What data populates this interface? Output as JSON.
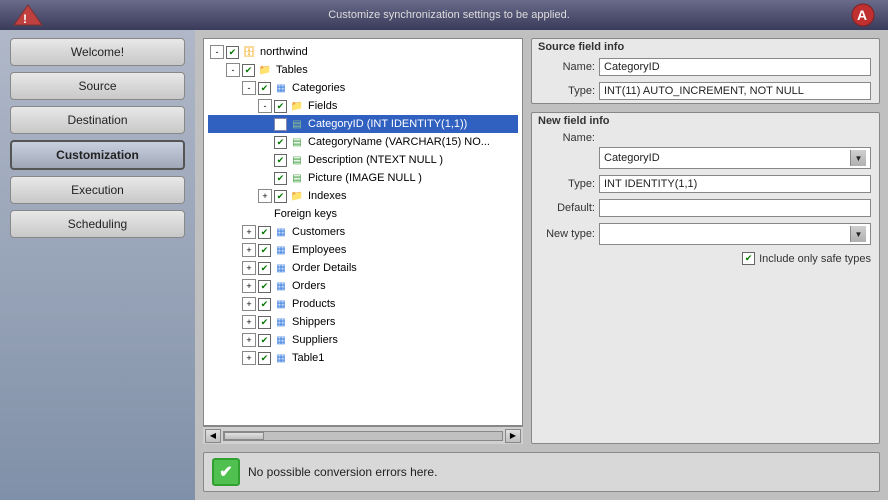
{
  "header": {
    "title": "Customize synchronization settings to be applied.",
    "logo_text": "🔧"
  },
  "sidebar": {
    "buttons": [
      {
        "id": "welcome",
        "label": "Welcome!",
        "active": false
      },
      {
        "id": "source",
        "label": "Source",
        "active": false
      },
      {
        "id": "destination",
        "label": "Destination",
        "active": false
      },
      {
        "id": "customization",
        "label": "Customization",
        "active": true
      },
      {
        "id": "execution",
        "label": "Execution",
        "active": false
      },
      {
        "id": "scheduling",
        "label": "Scheduling",
        "active": false
      }
    ]
  },
  "tree": {
    "root": "northwind",
    "items": [
      {
        "indent": 0,
        "expander": "-",
        "checked": true,
        "icon": "db",
        "label": "northwind"
      },
      {
        "indent": 1,
        "expander": "-",
        "checked": true,
        "icon": "folder",
        "label": "Tables"
      },
      {
        "indent": 2,
        "expander": "-",
        "checked": true,
        "icon": "table",
        "label": "Categories"
      },
      {
        "indent": 3,
        "expander": "-",
        "checked": true,
        "icon": "folder",
        "label": "Fields"
      },
      {
        "indent": 4,
        "expander": null,
        "checked": true,
        "icon": "field",
        "label": "CategoryID (INT IDENTITY(1,1))",
        "selected": true
      },
      {
        "indent": 4,
        "expander": null,
        "checked": true,
        "icon": "field",
        "label": "CategoryName (VARCHAR(15) NO..."
      },
      {
        "indent": 4,
        "expander": null,
        "checked": true,
        "icon": "field",
        "label": "Description (NTEXT NULL )"
      },
      {
        "indent": 4,
        "expander": null,
        "checked": true,
        "icon": "field",
        "label": "Picture (IMAGE NULL )"
      },
      {
        "indent": 3,
        "expander": "+",
        "checked": true,
        "icon": "folder",
        "label": "Indexes"
      },
      {
        "indent": 3,
        "expander": null,
        "checked": false,
        "icon": null,
        "label": "Foreign keys"
      },
      {
        "indent": 2,
        "expander": "+",
        "checked": true,
        "icon": "table",
        "label": "Customers"
      },
      {
        "indent": 2,
        "expander": "+",
        "checked": true,
        "icon": "table",
        "label": "Employees"
      },
      {
        "indent": 2,
        "expander": "+",
        "checked": true,
        "icon": "table",
        "label": "Order Details"
      },
      {
        "indent": 2,
        "expander": "+",
        "checked": true,
        "icon": "table",
        "label": "Orders"
      },
      {
        "indent": 2,
        "expander": "+",
        "checked": true,
        "icon": "table",
        "label": "Products"
      },
      {
        "indent": 2,
        "expander": "+",
        "checked": true,
        "icon": "table",
        "label": "Shippers"
      },
      {
        "indent": 2,
        "expander": "+",
        "checked": true,
        "icon": "table",
        "label": "Suppliers"
      },
      {
        "indent": 2,
        "expander": "+",
        "checked": true,
        "icon": "table",
        "label": "Table1"
      }
    ]
  },
  "source_field_info": {
    "title": "Source field info",
    "name_label": "Name:",
    "name_value": "CategoryID",
    "type_label": "Type:",
    "type_value": "INT(11) AUTO_INCREMENT, NOT NULL"
  },
  "new_field_info": {
    "title": "New field info",
    "name_label": "Name:",
    "name_value": "CategoryID",
    "name_options": [
      "CategoryID"
    ],
    "type_label": "Type:",
    "type_value": "INT IDENTITY(1,1)",
    "default_label": "Default:",
    "default_value": "",
    "new_type_label": "New type:",
    "new_type_value": "",
    "new_type_options": [],
    "checkbox_label": "Include only safe types",
    "checkbox_checked": true
  },
  "status": {
    "icon": "✔",
    "message": "No possible conversion errors here."
  }
}
